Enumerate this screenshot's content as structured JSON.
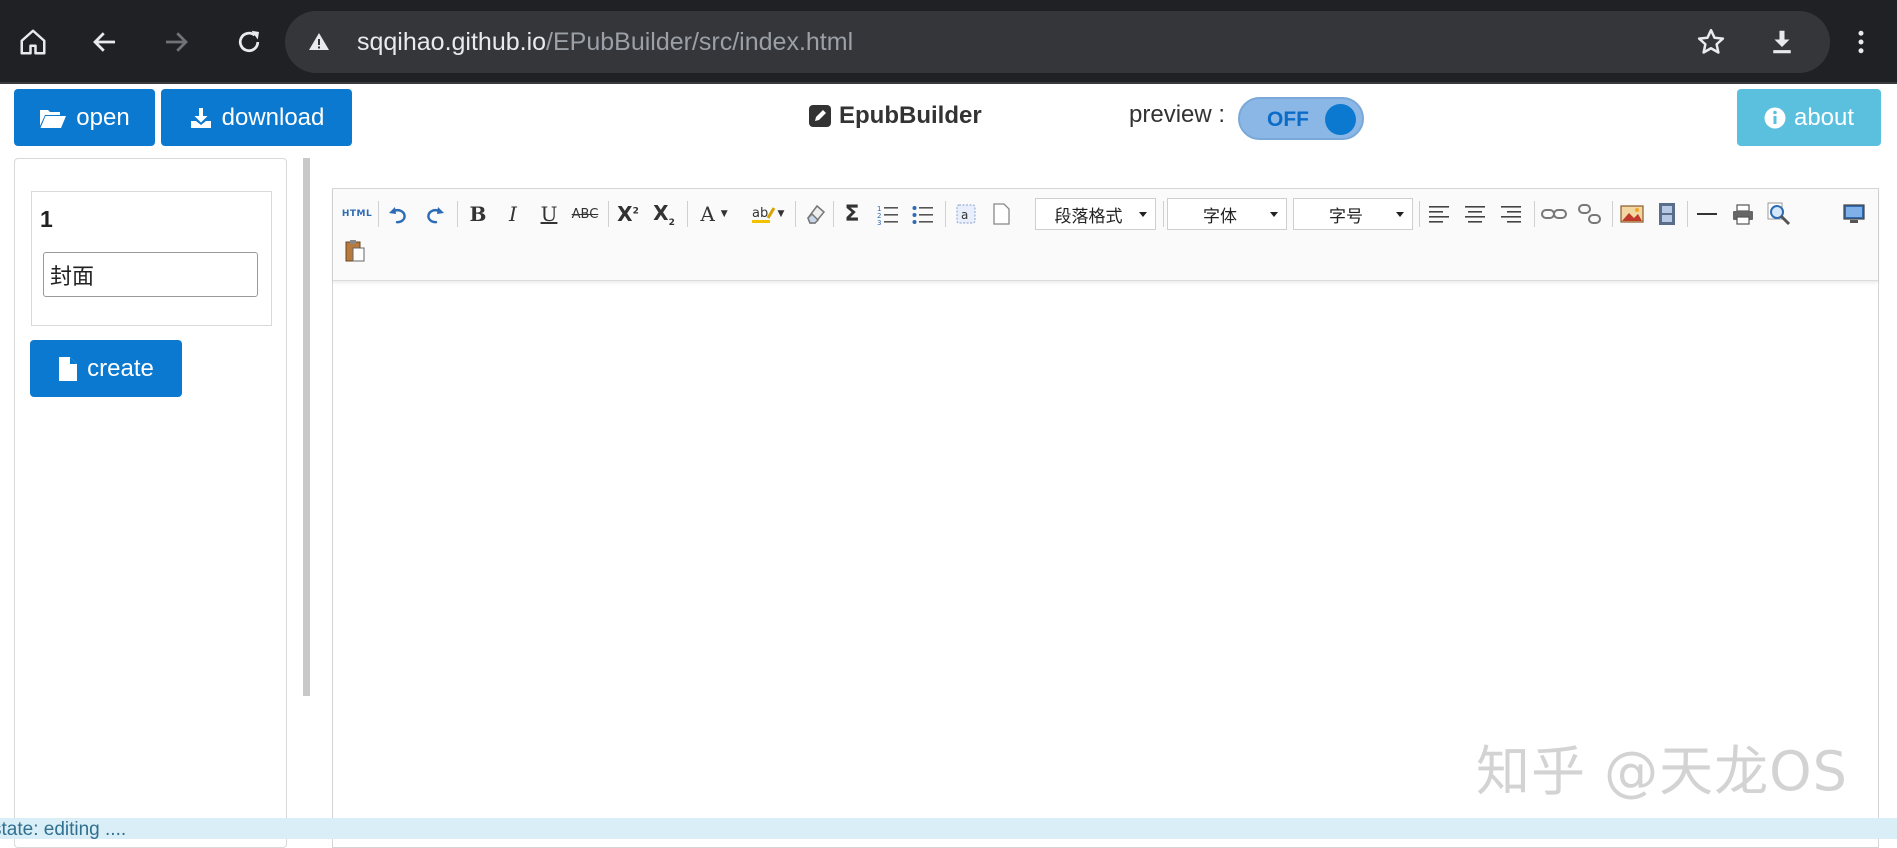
{
  "browser": {
    "url_host": "sqqihao.github.io",
    "url_path": "/EPubBuilder/src/index.html",
    "icons": [
      "home-icon",
      "back-icon",
      "forward-icon",
      "reload-icon",
      "warning-icon",
      "star-icon",
      "download-icon",
      "menu-dots-icon"
    ]
  },
  "header": {
    "open_label": "open",
    "download_label": "download",
    "title": "EpubBuilder",
    "preview_label": "preview :",
    "preview_state": "OFF",
    "about_label": "about"
  },
  "sidebar": {
    "chapters": [
      {
        "number": "1",
        "title": "封面"
      }
    ],
    "create_label": "create"
  },
  "toolbar": {
    "html_label": "HTML",
    "paragraph_label": "段落格式",
    "font_label": "字体",
    "size_label": "字号"
  },
  "watermark": "知乎 @天龙OS",
  "status": "state:  editing ....",
  "colors": {
    "primary": "#0b79d0",
    "about": "#5bc0de",
    "toggle_bg": "#8ab7e6",
    "status_bg": "#d9eef7",
    "chrome_bg": "#202124"
  }
}
